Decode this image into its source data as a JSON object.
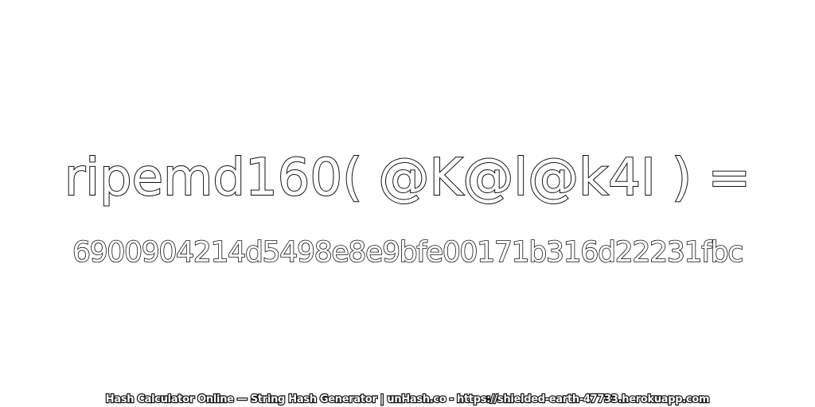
{
  "expression": "ripemd160( @K@l@k4I ) =",
  "hash_value": "6900904214d5498e8e9bfe00171b316d22231fbc",
  "footer_text": "Hash Calculator Online — String Hash Generator | unHash.co - https://shielded-earth-47733.herokuapp.com",
  "colors": {
    "background": "#ffffff",
    "text_fill": "#ffffff",
    "text_outline": "#111111"
  }
}
